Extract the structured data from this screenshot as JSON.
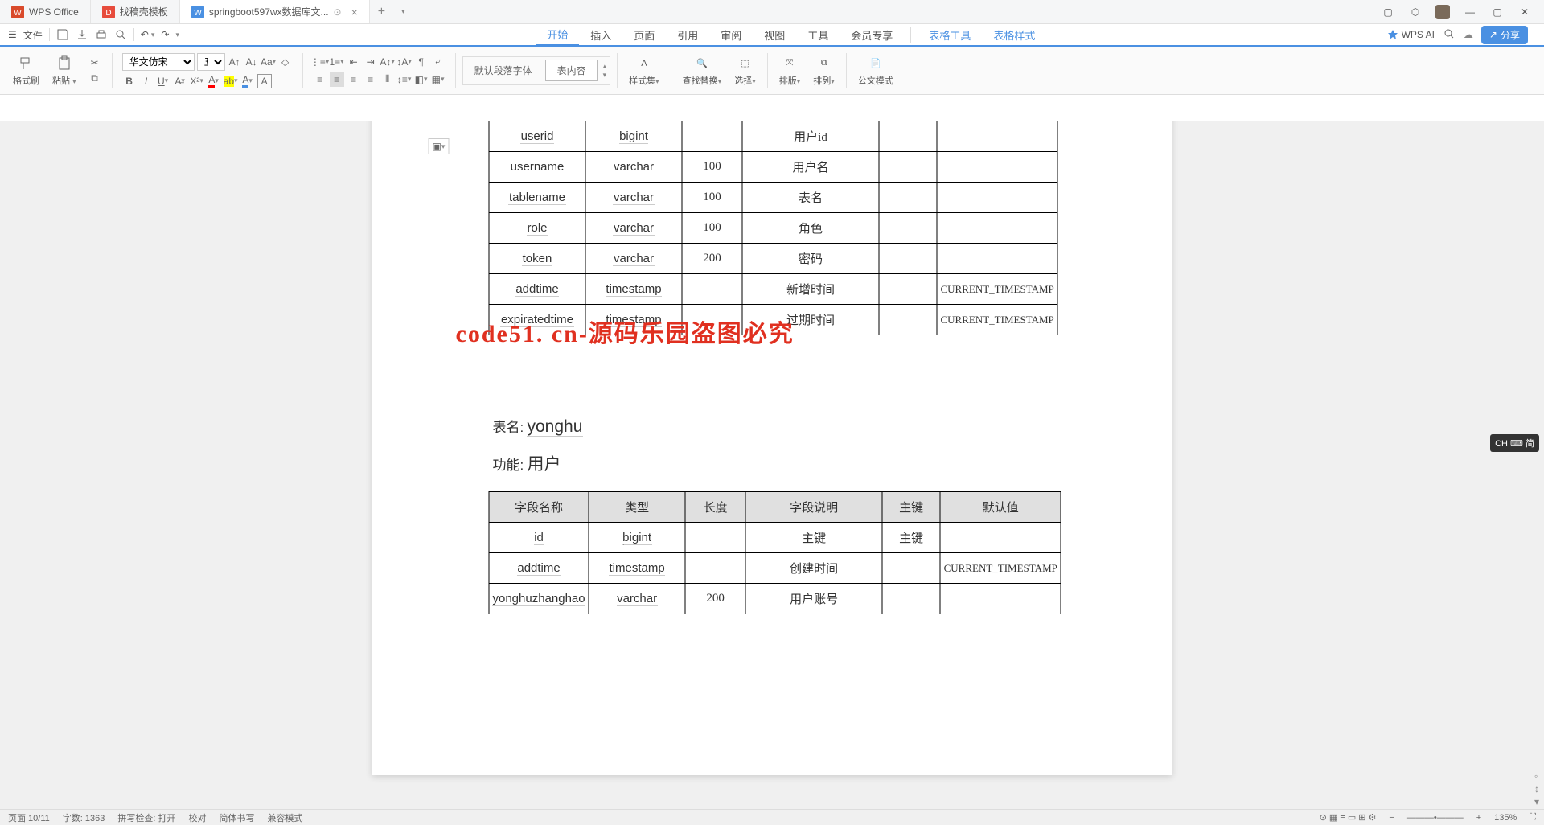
{
  "tabs": [
    {
      "label": "WPS Office",
      "icon": "#d94a2b"
    },
    {
      "label": "找稿壳模板",
      "icon": "#e74c3c"
    },
    {
      "label": "springboot597wx数据库文...",
      "icon": "#4a90e2",
      "active": true
    }
  ],
  "filebar": {
    "file": "文件"
  },
  "menu": {
    "items": [
      "开始",
      "插入",
      "页面",
      "引用",
      "审阅",
      "视图",
      "工具",
      "会员专享"
    ],
    "extra": [
      "表格工具",
      "表格样式"
    ],
    "ai": "WPS AI",
    "share": "分享"
  },
  "ribbon": {
    "brush": "格式刷",
    "paste": "粘贴",
    "font_name": "华文仿宋",
    "font_size": "五号",
    "style_default": "默认段落字体",
    "style_content": "表内容",
    "styles": "样式集",
    "find": "查找替换",
    "select": "选择",
    "sort": "排版",
    "arrange": "排列",
    "doc_mode": "公文模式"
  },
  "table1_rows": [
    {
      "f": "userid",
      "t": "bigint",
      "len": "",
      "desc": "用户id",
      "pk": "",
      "def": ""
    },
    {
      "f": "username",
      "t": "varchar",
      "len": "100",
      "desc": "用户名",
      "pk": "",
      "def": ""
    },
    {
      "f": "tablename",
      "t": "varchar",
      "len": "100",
      "desc": "表名",
      "pk": "",
      "def": ""
    },
    {
      "f": "role",
      "t": "varchar",
      "len": "100",
      "desc": "角色",
      "pk": "",
      "def": ""
    },
    {
      "f": "token",
      "t": "varchar",
      "len": "200",
      "desc": "密码",
      "pk": "",
      "def": ""
    },
    {
      "f": "addtime",
      "t": "timestamp",
      "len": "",
      "desc": "新增时间",
      "pk": "",
      "def": "CURRENT_TIMESTAMP"
    },
    {
      "f": "expiratedtime",
      "t": "timestamp",
      "len": "",
      "desc": "过期时间",
      "pk": "",
      "def": "CURRENT_TIMESTAMP"
    }
  ],
  "section2": {
    "name_label": "表名:",
    "name": "yonghu",
    "fn_label": "功能:",
    "fn": "用户"
  },
  "table2_headers": [
    "字段名称",
    "类型",
    "长度",
    "字段说明",
    "主键",
    "默认值"
  ],
  "table2_rows": [
    {
      "f": "id",
      "t": "bigint",
      "len": "",
      "desc": "主键",
      "pk": "主键",
      "def": ""
    },
    {
      "f": "addtime",
      "t": "timestamp",
      "len": "",
      "desc": "创建时间",
      "pk": "",
      "def": "CURRENT_TIMESTAMP"
    },
    {
      "f": "yonghuzhanghao",
      "t": "varchar",
      "len": "200",
      "desc": "用户账号",
      "pk": "",
      "def": ""
    }
  ],
  "watermark": "code51. cn-源码乐园盗图必究",
  "statusbar": {
    "page": "页面 10/11",
    "words": "字数: 1363",
    "spell": "拼写检查: 打开",
    "proof": "校对",
    "lang": "简体书写",
    "mode": "兼容模式"
  },
  "ime": "CH ⌨ 简",
  "zoom": "135%"
}
